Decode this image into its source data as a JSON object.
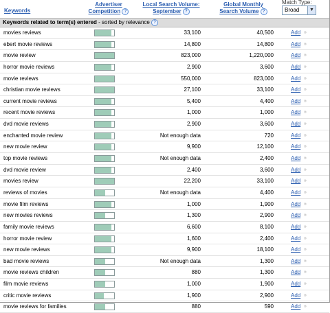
{
  "header": {
    "keywords": "Keywords",
    "competition_line1": "Advertiser",
    "competition_line2": "Competition",
    "local_line1": "Local Search Volume:",
    "local_line2": "September",
    "global_line1": "Global Monthly",
    "global_line2": "Search Volume",
    "help_glyph": "?",
    "match_type_label": "Match Type:",
    "match_type_value": "Broad",
    "dropdown_glyph": "▼"
  },
  "section": {
    "title": "Keywords related to term(s) entered",
    "subtitle": " - sorted by relevance",
    "help_glyph": "?"
  },
  "rows": [
    {
      "keyword": "movies reviews",
      "competition": 0.85,
      "local": "33,100",
      "global": "40,500",
      "action": "Add",
      "chevron": "»"
    },
    {
      "keyword": "ebert movie reviews",
      "competition": 0.85,
      "local": "14,800",
      "global": "14,800",
      "action": "Add",
      "chevron": "»"
    },
    {
      "keyword": "movie review",
      "competition": 1.0,
      "local": "823,000",
      "global": "1,220,000",
      "action": "Add",
      "chevron": "»"
    },
    {
      "keyword": "horror movie reviews",
      "competition": 0.85,
      "local": "2,900",
      "global": "3,600",
      "action": "Add",
      "chevron": "»"
    },
    {
      "keyword": "movie reviews",
      "competition": 1.0,
      "local": "550,000",
      "global": "823,000",
      "action": "Add",
      "chevron": "»"
    },
    {
      "keyword": "christian movie reviews",
      "competition": 1.0,
      "local": "27,100",
      "global": "33,100",
      "action": "Add",
      "chevron": "»"
    },
    {
      "keyword": "current movie reviews",
      "competition": 0.85,
      "local": "5,400",
      "global": "4,400",
      "action": "Add",
      "chevron": "»"
    },
    {
      "keyword": "recent movie reviews",
      "competition": 0.85,
      "local": "1,000",
      "global": "1,000",
      "action": "Add",
      "chevron": "»"
    },
    {
      "keyword": "dvd movie reviews",
      "competition": 0.85,
      "local": "2,900",
      "global": "3,600",
      "action": "Add",
      "chevron": "»"
    },
    {
      "keyword": "enchanted movie review",
      "competition": 0.85,
      "local": "Not enough data",
      "global": "720",
      "action": "Add",
      "chevron": "»"
    },
    {
      "keyword": "new movie review",
      "competition": 0.85,
      "local": "9,900",
      "global": "12,100",
      "action": "Add",
      "chevron": "»"
    },
    {
      "keyword": "top movie reviews",
      "competition": 0.85,
      "local": "Not enough data",
      "global": "2,400",
      "action": "Add",
      "chevron": "»"
    },
    {
      "keyword": "dvd movie review",
      "competition": 0.85,
      "local": "2,400",
      "global": "3,600",
      "action": "Add",
      "chevron": "»"
    },
    {
      "keyword": "movies review",
      "competition": 1.0,
      "local": "22,200",
      "global": "33,100",
      "action": "Add",
      "chevron": "»"
    },
    {
      "keyword": "reviews of movies",
      "competition": 0.55,
      "local": "Not enough data",
      "global": "4,400",
      "action": "Add",
      "chevron": "»"
    },
    {
      "keyword": "movie film reviews",
      "competition": 0.85,
      "local": "1,000",
      "global": "1,900",
      "action": "Add",
      "chevron": "»"
    },
    {
      "keyword": "new movies reviews",
      "competition": 0.55,
      "local": "1,300",
      "global": "2,900",
      "action": "Add",
      "chevron": "»"
    },
    {
      "keyword": "family movie reviews",
      "competition": 0.85,
      "local": "6,600",
      "global": "8,100",
      "action": "Add",
      "chevron": "»"
    },
    {
      "keyword": "horror movie review",
      "competition": 0.85,
      "local": "1,600",
      "global": "2,400",
      "action": "Add",
      "chevron": "»"
    },
    {
      "keyword": "new movie reviews",
      "competition": 0.85,
      "local": "9,900",
      "global": "18,100",
      "action": "Add",
      "chevron": "»"
    },
    {
      "keyword": "bad movie reviews",
      "competition": 0.55,
      "local": "Not enough data",
      "global": "1,300",
      "action": "Add",
      "chevron": "»"
    },
    {
      "keyword": "movie reviews children",
      "competition": 0.55,
      "local": "880",
      "global": "1,300",
      "action": "Add",
      "chevron": "»"
    },
    {
      "keyword": "film movie reviews",
      "competition": 0.55,
      "local": "1,000",
      "global": "1,900",
      "action": "Add",
      "chevron": "»"
    },
    {
      "keyword": "critic movie reviews",
      "competition": 0.45,
      "local": "1,900",
      "global": "2,900",
      "action": "Add",
      "chevron": "»"
    },
    {
      "keyword": "movie reviews for families",
      "competition": 0.55,
      "local": "880",
      "global": "590",
      "action": "Add",
      "chevron": "»"
    }
  ],
  "colors": {
    "link": "#2a5db0",
    "bar_fill": "#9fccb8",
    "section_bg": "#dcdcdc"
  }
}
